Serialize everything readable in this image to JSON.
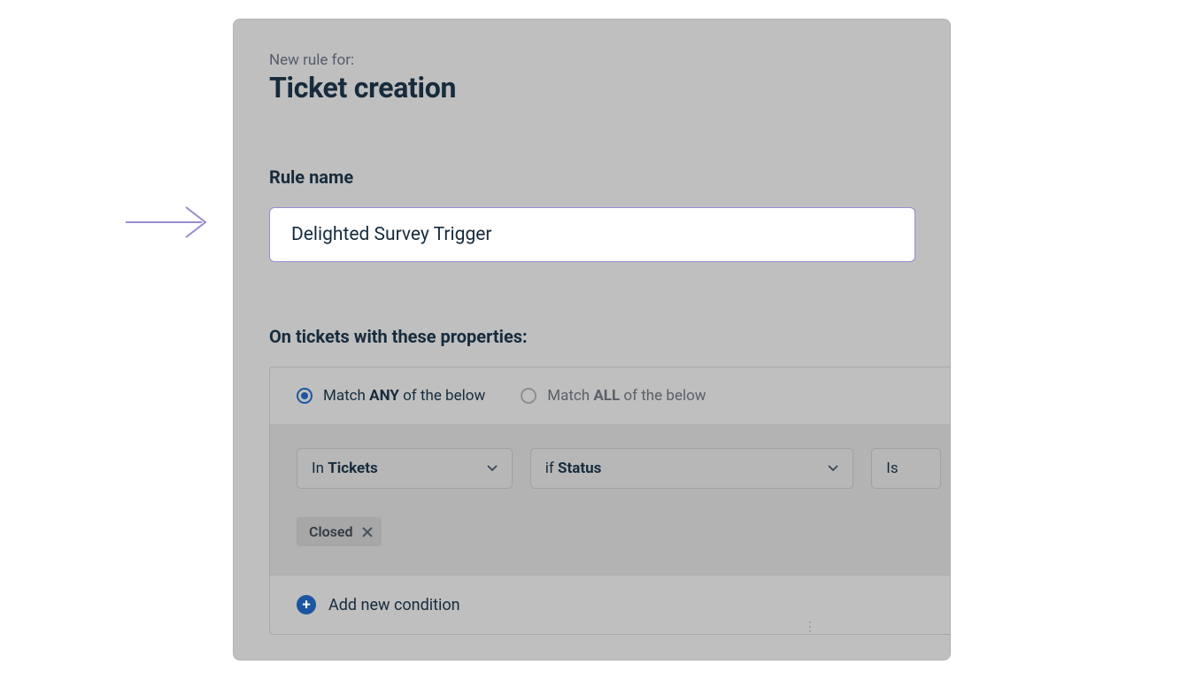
{
  "header": {
    "subtitle": "New rule for:",
    "title": "Ticket creation"
  },
  "rule_name": {
    "label": "Rule name",
    "value": "Delighted Survey Trigger"
  },
  "conditions": {
    "heading": "On tickets with these properties:",
    "match_any": {
      "prefix": "Match ",
      "bold": "ANY",
      "suffix": " of the below"
    },
    "match_all": {
      "prefix": "Match ",
      "bold": "ALL",
      "suffix": " of the below"
    },
    "selected_match": "any",
    "row": {
      "scope": {
        "prefix": "In ",
        "bold": "Tickets"
      },
      "field": {
        "prefix": "if ",
        "bold": "Status"
      },
      "operator": "Is",
      "values": [
        "Closed"
      ]
    },
    "add_label": "Add new condition"
  }
}
